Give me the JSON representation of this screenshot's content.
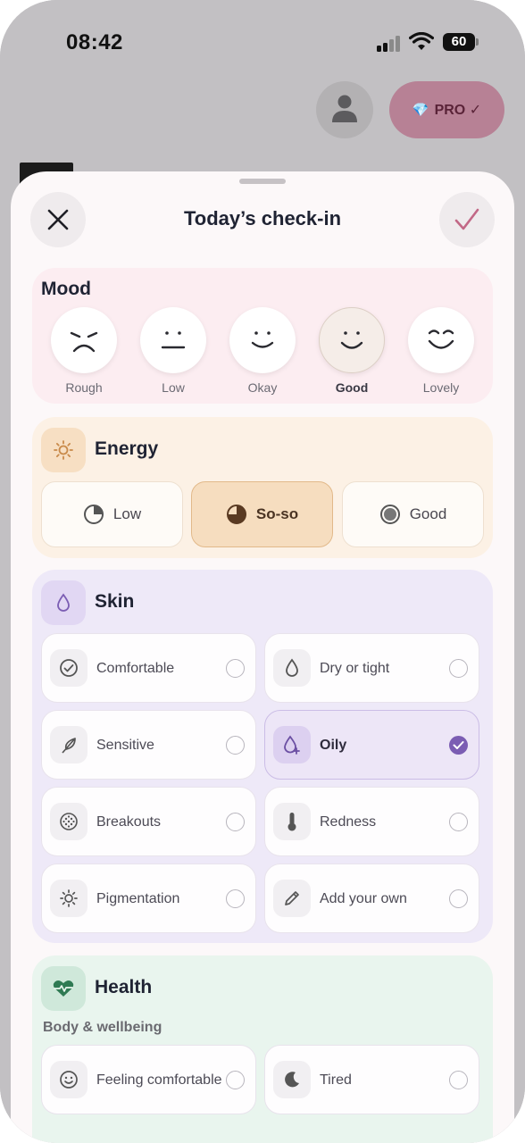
{
  "status_bar": {
    "time": "08:42",
    "battery": "60"
  },
  "background": {
    "pro_label": "PRO ✓"
  },
  "sheet": {
    "title": "Today’s check-in"
  },
  "mood": {
    "title": "Mood",
    "options": [
      {
        "label": "Rough",
        "selected": false
      },
      {
        "label": "Low",
        "selected": false
      },
      {
        "label": "Okay",
        "selected": false
      },
      {
        "label": "Good",
        "selected": true
      },
      {
        "label": "Lovely",
        "selected": false
      }
    ]
  },
  "energy": {
    "title": "Energy",
    "options": [
      {
        "label": "Low",
        "selected": false
      },
      {
        "label": "So-so",
        "selected": true
      },
      {
        "label": "Good",
        "selected": false
      }
    ]
  },
  "skin": {
    "title": "Skin",
    "options": [
      {
        "label": "Comfortable",
        "icon": "check-circle-icon",
        "selected": false
      },
      {
        "label": "Dry or tight",
        "icon": "droplet-icon",
        "selected": false
      },
      {
        "label": "Sensitive",
        "icon": "feather-icon",
        "selected": false
      },
      {
        "label": "Oily",
        "icon": "droplet-plus-icon",
        "selected": true
      },
      {
        "label": "Breakouts",
        "icon": "dotted-circle-icon",
        "selected": false
      },
      {
        "label": "Redness",
        "icon": "thermometer-icon",
        "selected": false
      },
      {
        "label": "Pigmentation",
        "icon": "sun-spot-icon",
        "selected": false
      },
      {
        "label": "Add your own",
        "icon": "pencil-icon",
        "selected": false
      }
    ]
  },
  "health": {
    "title": "Health",
    "subtitle": "Body & wellbeing",
    "options": [
      {
        "label": "Feeling comfortable",
        "icon": "smile-icon",
        "selected": false
      },
      {
        "label": "Tired",
        "icon": "moon-icon",
        "selected": false
      }
    ]
  },
  "colors": {
    "accent": "#7b5db3",
    "mood_bg": "#fcedf1",
    "energy_bg": "#fcf1e5",
    "skin_bg": "#eee9f8",
    "health_bg": "#e9f5ee",
    "confirm_check": "#c26886"
  }
}
